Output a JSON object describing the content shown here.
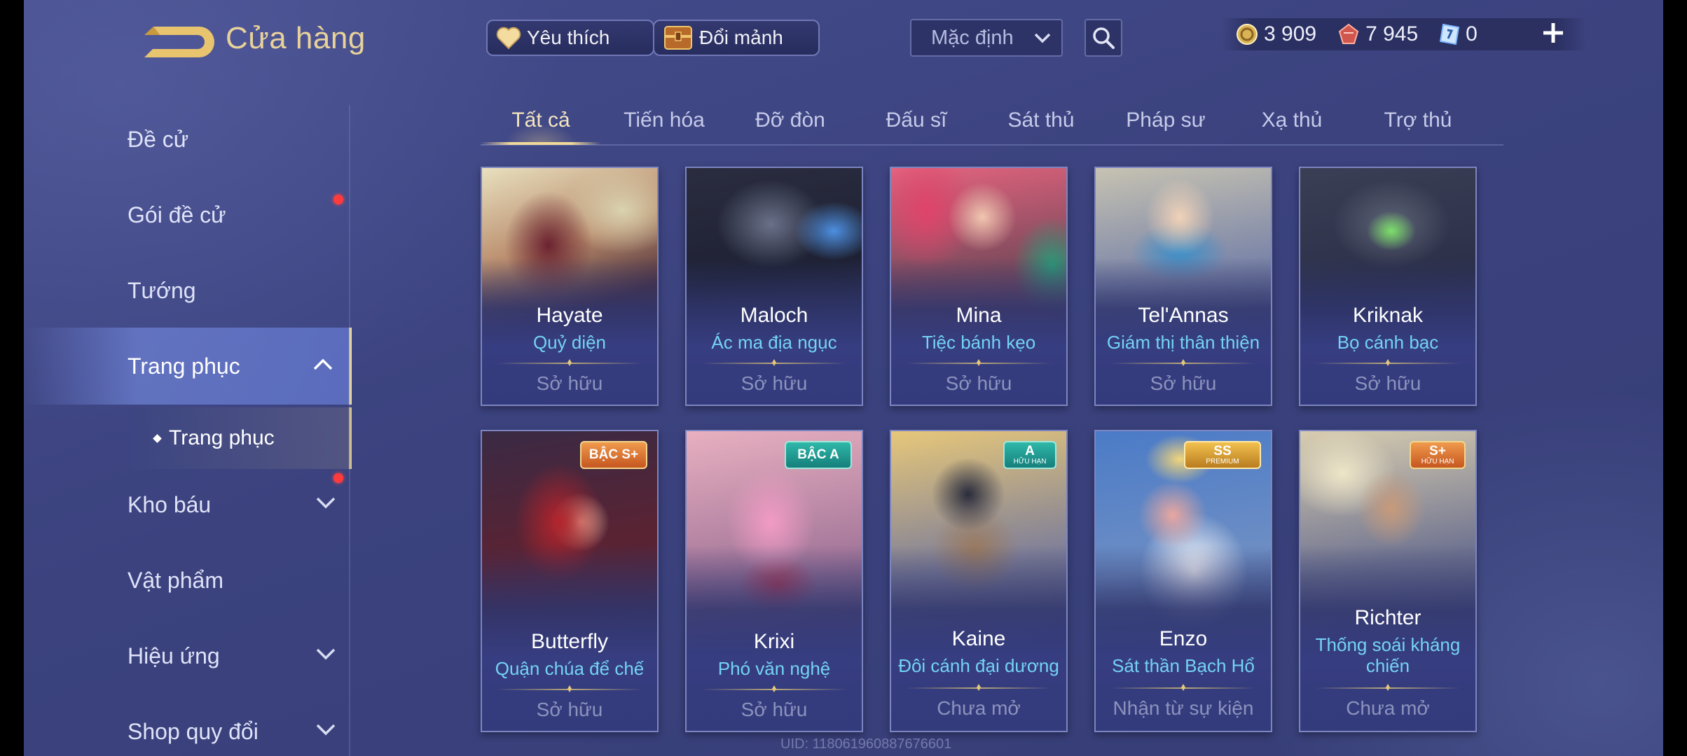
{
  "header": {
    "title": "Cửa hàng",
    "favorite_label": "Yêu thích",
    "shard_label": "Đổi mảnh",
    "sort_selected": "Mặc định",
    "currencies": [
      {
        "icon": "gold-coin-icon",
        "value": "3 909"
      },
      {
        "icon": "red-gem-icon",
        "value": "7 945"
      },
      {
        "icon": "voucher-icon",
        "value": "0"
      }
    ]
  },
  "sidebar": {
    "items": [
      {
        "label": "Đề cử"
      },
      {
        "label": "Gói đề cử",
        "dot": true
      },
      {
        "label": "Tướng"
      },
      {
        "label": "Trang phục",
        "active": true,
        "chevron": "up"
      },
      {
        "label": "Kho báu",
        "dot": true,
        "chevron": "down"
      },
      {
        "label": "Vật phẩm"
      },
      {
        "label": "Hiệu ứng",
        "chevron": "down"
      },
      {
        "label": "Shop quy đổi",
        "chevron": "down"
      }
    ],
    "subitem": "Trang phục"
  },
  "tabs": [
    "Tất cả",
    "Tiến hóa",
    "Đỡ đòn",
    "Đấu sĩ",
    "Sát thủ",
    "Pháp sư",
    "Xạ thủ",
    "Trợ thủ"
  ],
  "cards": [
    {
      "hero": "Hayate",
      "skin": "Quỷ diện",
      "status": "Sở hữu"
    },
    {
      "hero": "Maloch",
      "skin": "Ác ma địa ngục",
      "status": "Sở hữu"
    },
    {
      "hero": "Mina",
      "skin": "Tiệc bánh kẹo",
      "status": "Sở hữu"
    },
    {
      "hero": "Tel'Annas",
      "skin": "Giám thị thân thiện",
      "status": "Sở hữu"
    },
    {
      "hero": "Kriknak",
      "skin": "Bọ cánh bạc",
      "status": "Sở hữu"
    },
    {
      "hero": "Butterfly",
      "skin": "Quận chúa để chế",
      "status": "Sở hữu",
      "badge": "BẬC S+"
    },
    {
      "hero": "Krixi",
      "skin": "Phó văn nghệ",
      "status": "Sở hữu",
      "badge": "BẬC A"
    },
    {
      "hero": "Kaine",
      "skin": "Đôi cánh đại dương",
      "status": "Chưa mở",
      "badge": "A",
      "badge_sub": "HỮU HẠN"
    },
    {
      "hero": "Enzo",
      "skin": "Sát thần Bạch Hổ",
      "status": "Nhận từ sự kiện",
      "badge": "SS",
      "badge_sub": "PREMIUM"
    },
    {
      "hero": "Richter",
      "skin": "Thống soái kháng chiến",
      "status": "Chưa mở",
      "badge": "S+",
      "badge_sub": "HỮU HẠN"
    }
  ],
  "footer": {
    "uid": "UID: 118061960887676601"
  },
  "colors": {
    "accent_gold": "#f1d99a",
    "skin_name": "#74d3f4",
    "notification": "#ff3b3b"
  }
}
